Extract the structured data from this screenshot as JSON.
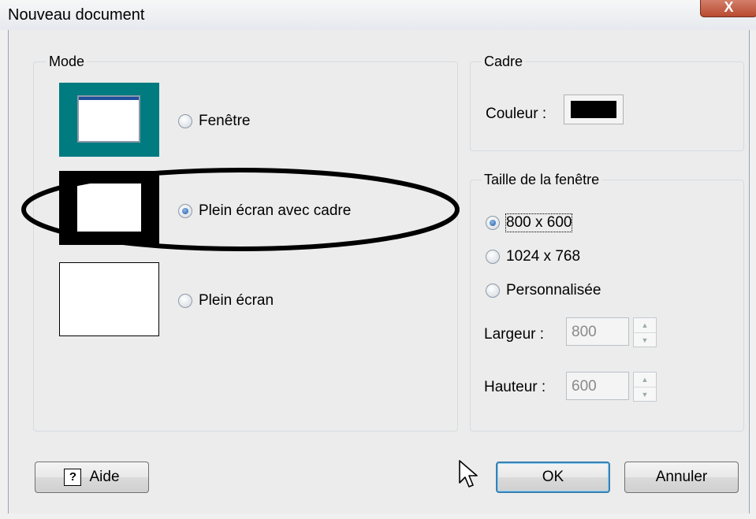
{
  "window": {
    "title": "Nouveau document",
    "close_glyph": "X"
  },
  "mode": {
    "legend": "Mode",
    "options": [
      {
        "label": "Fenêtre",
        "checked": false,
        "preview_icon": "window-preview-icon"
      },
      {
        "label": "Plein écran avec cadre",
        "checked": true,
        "preview_icon": "fullscreen-frame-preview-icon"
      },
      {
        "label": "Plein écran",
        "checked": false,
        "preview_icon": "fullscreen-preview-icon"
      }
    ]
  },
  "cadre": {
    "legend": "Cadre",
    "color_label": "Couleur :",
    "color_value": "#000000"
  },
  "taille": {
    "legend": "Taille de la fenêtre",
    "options": [
      {
        "label": "800 x 600",
        "checked": true
      },
      {
        "label": "1024 x 768",
        "checked": false
      },
      {
        "label": "Personnalisée",
        "checked": false
      }
    ],
    "largeur_label": "Largeur :",
    "largeur_value": "800",
    "hauteur_label": "Hauteur :",
    "hauteur_value": "600"
  },
  "buttons": {
    "help_icon_glyph": "?",
    "help_label": "Aide",
    "ok_label": "OK",
    "cancel_label": "Annuler"
  },
  "colors": {
    "teal": "#007b80",
    "highlight_ring": "#000000"
  }
}
